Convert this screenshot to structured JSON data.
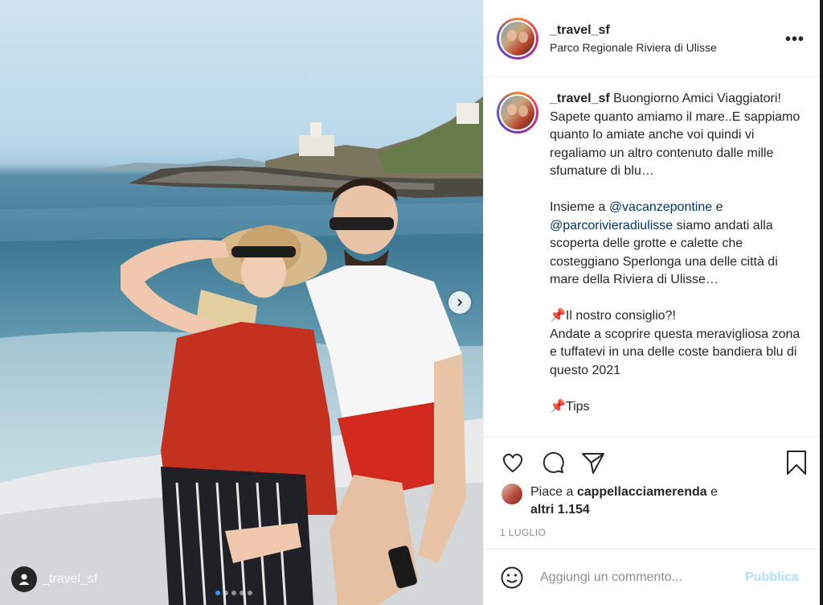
{
  "post": {
    "username": "_travel_sf",
    "location": "Parco Regionale Riviera di Ulisse",
    "more_label": "•••"
  },
  "caption": {
    "username": "_travel_sf",
    "line1": " Buongiorno Amici Viaggiatori!",
    "line2": "Sapete quanto amiamo il mare..E sappiamo quanto lo amiate anche voi quindi vi regaliamo un altro contenuto dalle mille sfumature di blu…",
    "line3_pre": "Insieme a ",
    "mention1": "@vacanzepontine",
    "line3_mid": " e ",
    "mention2": "@parcorivieradiulisse",
    "line3_post": " siamo andati alla scoperta delle grotte e calette che costeggiano Sperlonga una delle città di mare della Riviera di Ulisse…",
    "line4": "📌Il nostro consiglio?!",
    "line5": "Andate a scoprire questa meravigliosa zona e tuffatevi in una delle coste bandiera blu di questo 2021",
    "line6": "📌Tips"
  },
  "likes": {
    "prefix": "Piace a ",
    "user": "cappellacciamerenda",
    "mid": " e",
    "others": "altri 1.154"
  },
  "date": "1 LUGLIO",
  "comment": {
    "placeholder": "Aggiungi un commento...",
    "publish": "Pubblica"
  },
  "photo": {
    "tagged_user": "_travel_sf",
    "slide_count": 5,
    "active_slide": 1
  },
  "colors": {
    "accent_blue": "#3897f0",
    "mention": "#00376b",
    "publish_disabled": "#b2dffc",
    "muted": "#8e8e8e"
  },
  "icons": [
    "heart-icon",
    "comment-icon",
    "share-icon",
    "bookmark-icon",
    "emoji-icon",
    "more-icon",
    "chevron-right-icon",
    "user-tag-icon"
  ]
}
